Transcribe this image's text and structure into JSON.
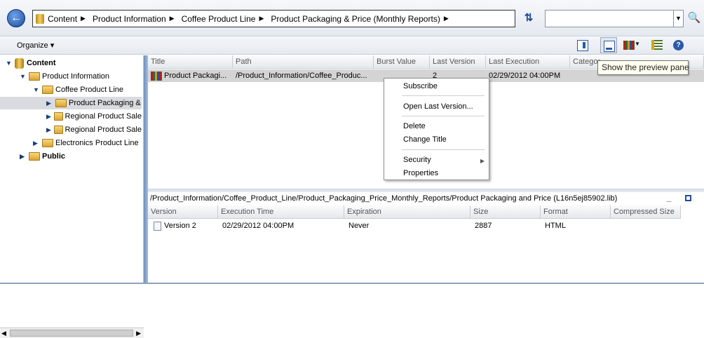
{
  "breadcrumb": {
    "items": [
      "Content",
      "Product Information",
      "Coffee Product Line",
      "Product Packaging & Price (Monthly Reports)"
    ]
  },
  "search": {
    "value": ""
  },
  "toolbar": {
    "organize_label": "Organize",
    "tooltip": "Show the preview pane"
  },
  "tree": {
    "items": [
      {
        "label": "Content",
        "bold": true
      },
      {
        "label": "Product Information"
      },
      {
        "label": "Coffee Product Line"
      },
      {
        "label": "Product Packaging &"
      },
      {
        "label": "Regional Product Sale"
      },
      {
        "label": "Regional Product Sale"
      },
      {
        "label": "Electronics Product Line"
      },
      {
        "label": "Public",
        "bold": true
      }
    ]
  },
  "main_grid": {
    "columns": [
      "Title",
      "Path",
      "Burst Value",
      "Last Version",
      "Last Execution",
      "Categor"
    ],
    "row": {
      "title": "Product Packagi...",
      "path": "/Product_Information/Coffee_Produc...",
      "burst": "",
      "last_version": "2",
      "last_execution": "02/29/2012 04:00PM",
      "category": ""
    }
  },
  "context_menu": {
    "subscribe": "Subscribe",
    "open_last_version": "Open Last Version...",
    "delete": "Delete",
    "change_title": "Change Title",
    "security": "Security",
    "properties": "Properties"
  },
  "detail": {
    "path": "/Product_Information/Coffee_Product_Line/Product_Packaging_Price_Monthly_Reports/Product Packaging and Price (L16n5ej85902.lib)",
    "columns": [
      "Version",
      "Execution Time",
      "Expiration",
      "Size",
      "Format",
      "Compressed Size"
    ],
    "row": {
      "version": "Version 2",
      "execution_time": "02/29/2012 04:00PM",
      "expiration": "Never",
      "size": "2887",
      "format": "HTML",
      "compressed_size": ""
    }
  }
}
